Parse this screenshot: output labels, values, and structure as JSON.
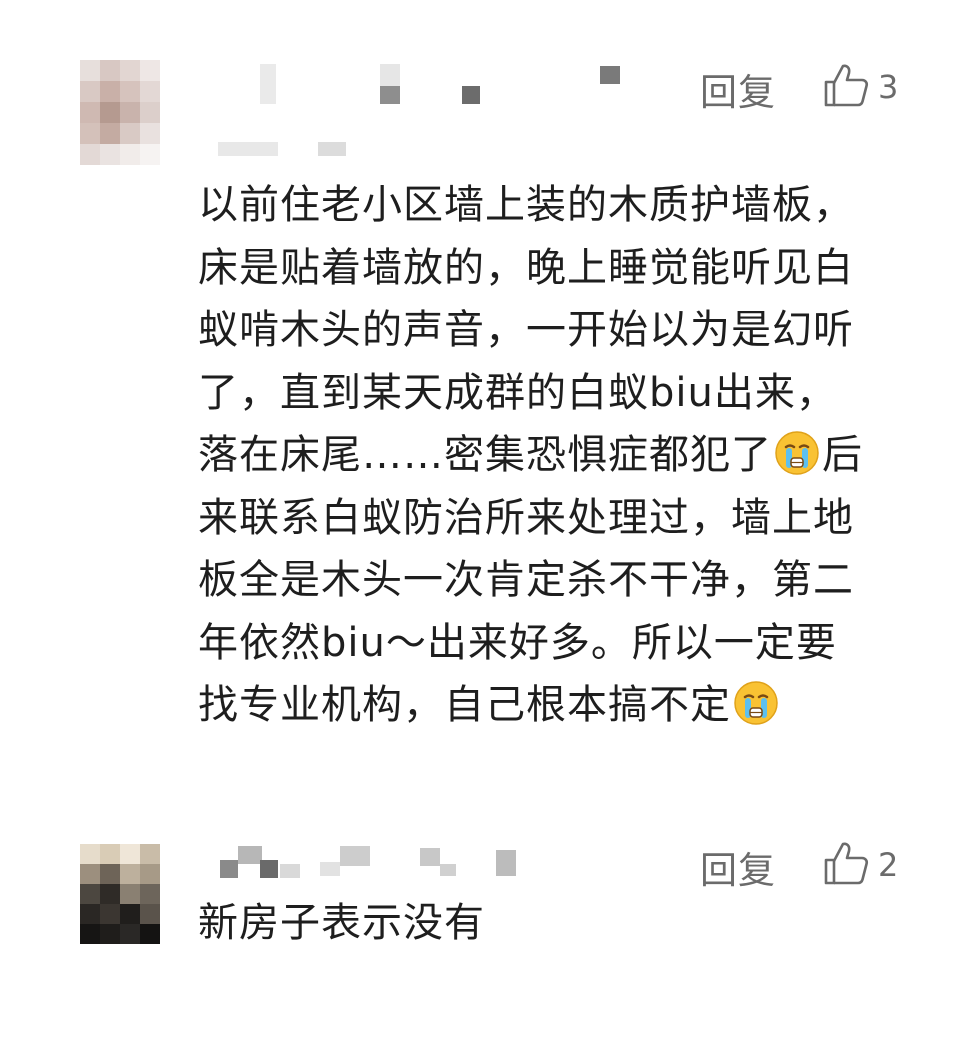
{
  "comments": [
    {
      "reply_label": "回复",
      "like_count": "3",
      "text_before_emoji_1": "以前住老小区墙上装的木质护墙板，\n床是贴着墙放的，晚上睡觉能听见白\n蚁啃木头的声音，一开始以为是幻听\n了，直到某天成群的白蚁biu出来，\n落在床尾……密集恐惧症都犯了",
      "text_after_emoji_1": "后\n来联系白蚁防治所来处理过，墙上地\n板全是木头一次肯定杀不干净，第二\n年依然biu～出来好多。所以一定要\n找专业机构，自己根本搞不定",
      "emoji": "crying-face-emoji"
    },
    {
      "reply_label": "回复",
      "like_count": "2",
      "text": "新房子表示没有"
    }
  ],
  "colors": {
    "text": "#1e1e1e",
    "meta": "#6b6b6b",
    "background": "#ffffff"
  }
}
